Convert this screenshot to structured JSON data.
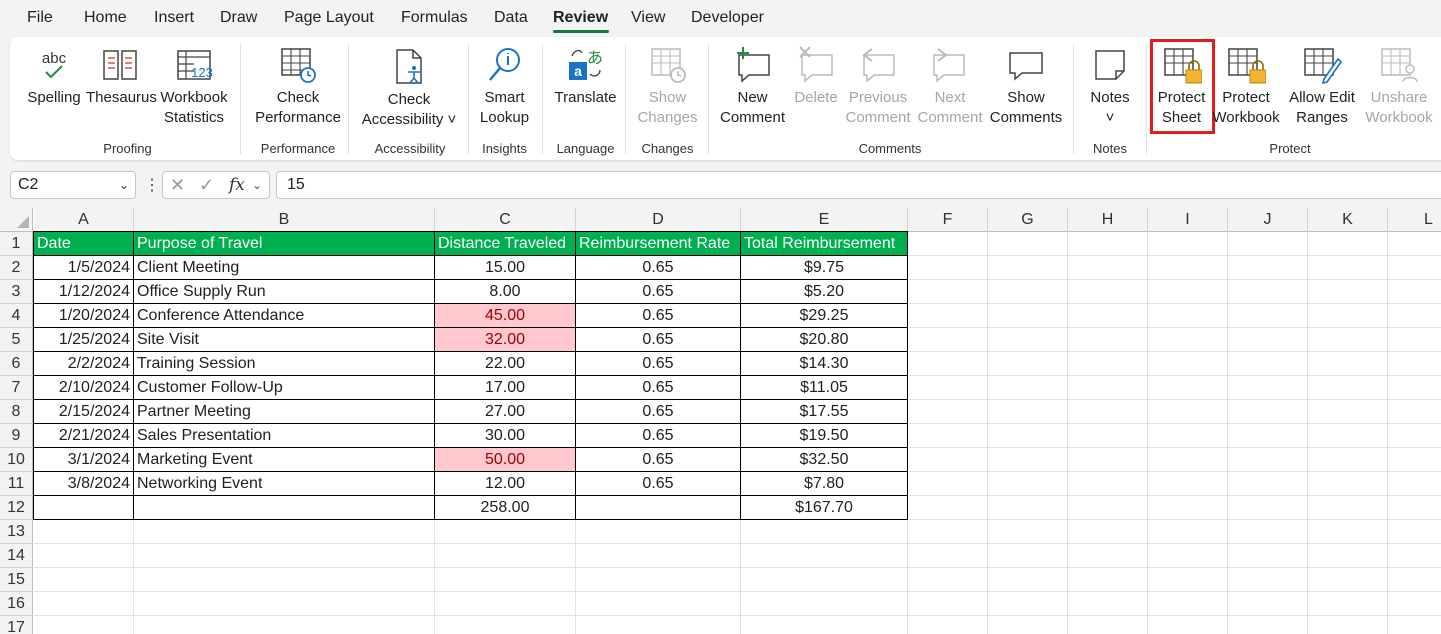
{
  "menu": {
    "tabs": [
      "File",
      "Home",
      "Insert",
      "Draw",
      "Page Layout",
      "Formulas",
      "Data",
      "Review",
      "View",
      "Developer"
    ],
    "active_tab": "Review"
  },
  "ribbon": {
    "groups": {
      "proofing": "Proofing",
      "performance": "Performance",
      "accessibility": "Accessibility",
      "insights": "Insights",
      "language": "Language",
      "changes": "Changes",
      "comments": "Comments",
      "notes": "Notes",
      "protect": "Protect"
    },
    "buttons": {
      "spelling": "Spelling",
      "thesaurus": "Thesaurus",
      "workbook_statistics": "Workbook\nStatistics",
      "check_performance": "Check\nPerformance",
      "check_accessibility": "Check\nAccessibility ˅",
      "smart_lookup": "Smart\nLookup",
      "translate": "Translate",
      "show_changes": "Show\nChanges",
      "new_comment": "New\nComment",
      "delete": "Delete",
      "previous_comment": "Previous\nComment",
      "next_comment": "Next\nComment",
      "show_comments": "Show\nComments",
      "notes": "Notes\n˅",
      "protect_sheet": "Protect\nSheet",
      "protect_workbook": "Protect\nWorkbook",
      "allow_edit_ranges": "Allow Edit\nRanges",
      "unshare_workbook": "Unshare\nWorkbook"
    },
    "icon_text": {
      "spelling": "abc",
      "workbook_statistics": "123",
      "translate": "あ"
    }
  },
  "formula_bar": {
    "name_box": "C2",
    "fx": "fx",
    "value": "15"
  },
  "sheet": {
    "columns": [
      "A",
      "B",
      "C",
      "D",
      "E",
      "F",
      "G",
      "H",
      "I",
      "J",
      "K",
      "L"
    ],
    "rows": [
      "1",
      "2",
      "3",
      "4",
      "5",
      "6",
      "7",
      "8",
      "9",
      "10",
      "11",
      "12",
      "13",
      "14",
      "15",
      "16",
      "17"
    ],
    "header": [
      "Date",
      "Purpose of Travel",
      "Distance Traveled",
      "Reimbursement Rate",
      "Total Reimbursement"
    ],
    "data": [
      [
        "1/5/2024",
        "Client Meeting",
        "15.00",
        "0.65",
        "$9.75"
      ],
      [
        "1/12/2024",
        "Office Supply Run",
        "8.00",
        "0.65",
        "$5.20"
      ],
      [
        "1/20/2024",
        "Conference Attendance",
        "45.00",
        "0.65",
        "$29.25"
      ],
      [
        "1/25/2024",
        "Site Visit",
        "32.00",
        "0.65",
        "$20.80"
      ],
      [
        "2/2/2024",
        "Training Session",
        "22.00",
        "0.65",
        "$14.30"
      ],
      [
        "2/10/2024",
        "Customer Follow-Up",
        "17.00",
        "0.65",
        "$11.05"
      ],
      [
        "2/15/2024",
        "Partner Meeting",
        "27.00",
        "0.65",
        "$17.55"
      ],
      [
        "2/21/2024",
        "Sales Presentation",
        "30.00",
        "0.65",
        "$19.50"
      ],
      [
        "3/1/2024",
        "Marketing Event",
        "50.00",
        "0.65",
        "$32.50"
      ],
      [
        "3/8/2024",
        "Networking Event",
        "12.00",
        "0.65",
        "$7.80"
      ]
    ],
    "totals": [
      "",
      "",
      "258.00",
      "",
      "$167.70"
    ],
    "highlighted_rows": [
      2,
      3,
      8
    ],
    "colors": {
      "header_fill": "#00b050",
      "highlight_fill": "#ffc7ce",
      "highlight_text": "#9c0006",
      "accent": "#0f7b3e",
      "callout": "#e31b1b"
    }
  }
}
